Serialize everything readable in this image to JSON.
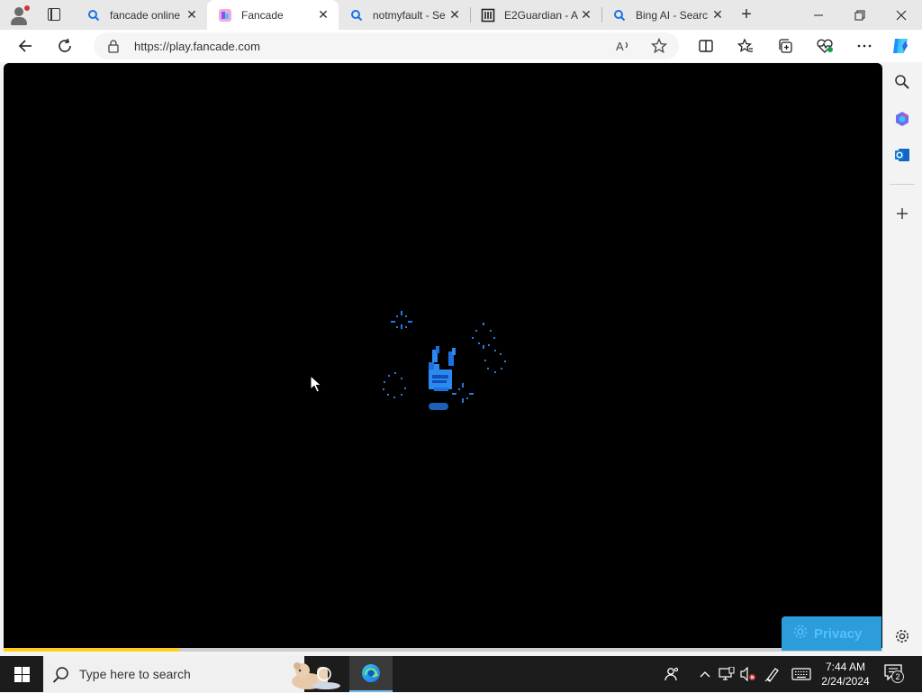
{
  "browser": {
    "tabs": [
      {
        "label": "fancade online",
        "icon": "search-icon"
      },
      {
        "label": "Fancade",
        "icon": "fancade-icon",
        "active": true
      },
      {
        "label": "notmyfault - Se",
        "icon": "search-icon"
      },
      {
        "label": "E2Guardian - A",
        "icon": "e2guardian-icon"
      },
      {
        "label": "Bing AI - Searc",
        "icon": "search-icon"
      }
    ],
    "url": "https://play.fancade.com",
    "loading_progress": 0.2,
    "accent_color": "#ffcf1a"
  },
  "page": {
    "privacy_label": "Privacy",
    "privacy_color": "#2d9cdb"
  },
  "taskbar": {
    "search_placeholder": "Type here to search",
    "time": "7:44 AM",
    "date": "2/24/2024",
    "notification_count": "2"
  }
}
